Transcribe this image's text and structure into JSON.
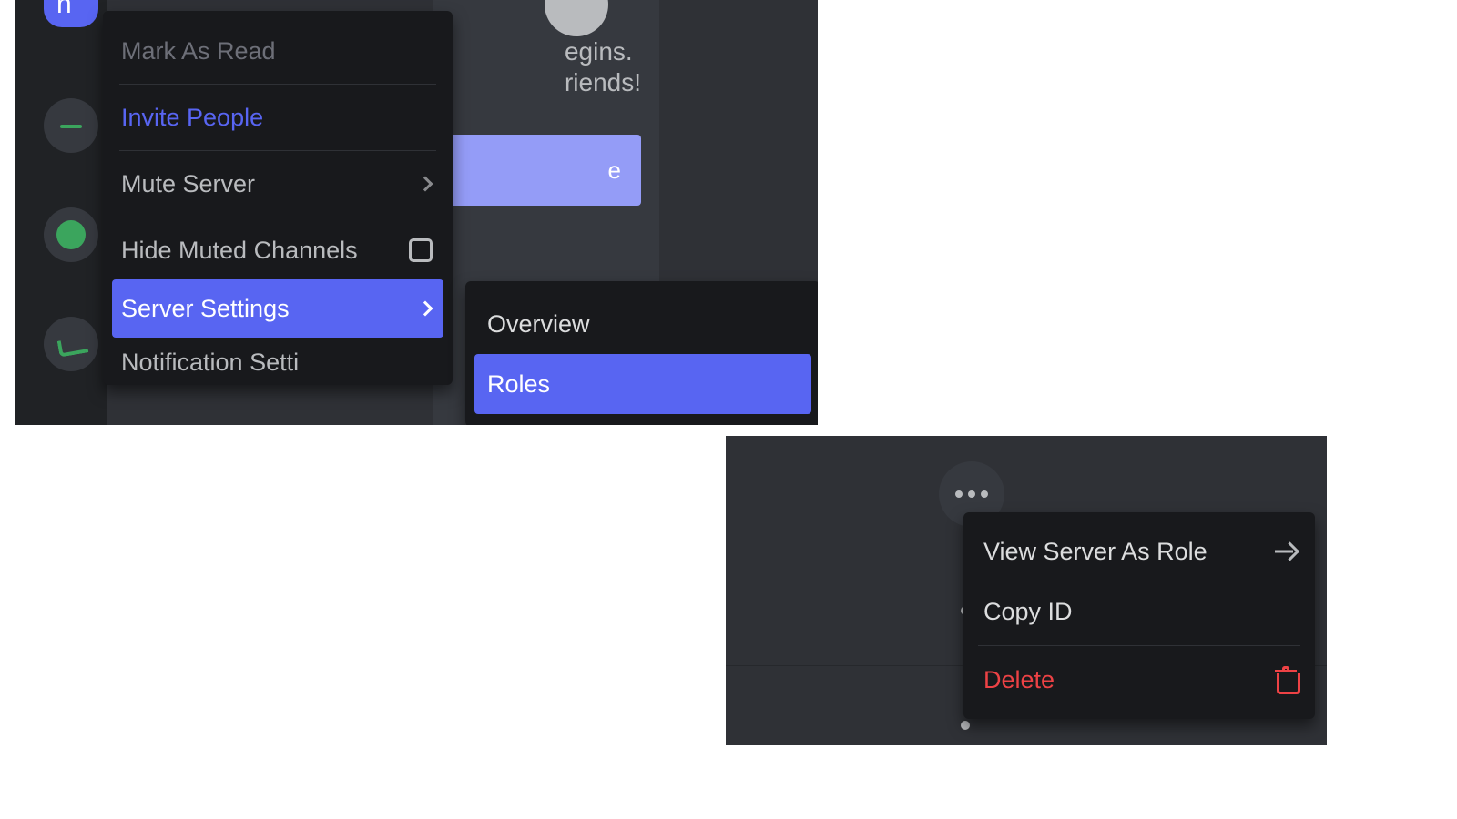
{
  "panel_a": {
    "rail_selected_letter": "n",
    "welcome": {
      "line1_fragment_right": "egins.",
      "line2_fragment_right": "riends!",
      "button_fragment_right": "e"
    },
    "context_menu": {
      "mark_as_read": "Mark As Read",
      "invite_people": "Invite People",
      "mute_server": "Mute Server",
      "hide_muted_channels": "Hide Muted Channels",
      "server_settings": "Server Settings",
      "notification_settings_fragment": "Notification Setti"
    },
    "server_settings_submenu": {
      "overview": "Overview",
      "roles": "Roles"
    }
  },
  "panel_b": {
    "context_menu": {
      "view_server_as_role": "View Server As Role",
      "copy_id": "Copy ID",
      "delete": "Delete"
    }
  }
}
